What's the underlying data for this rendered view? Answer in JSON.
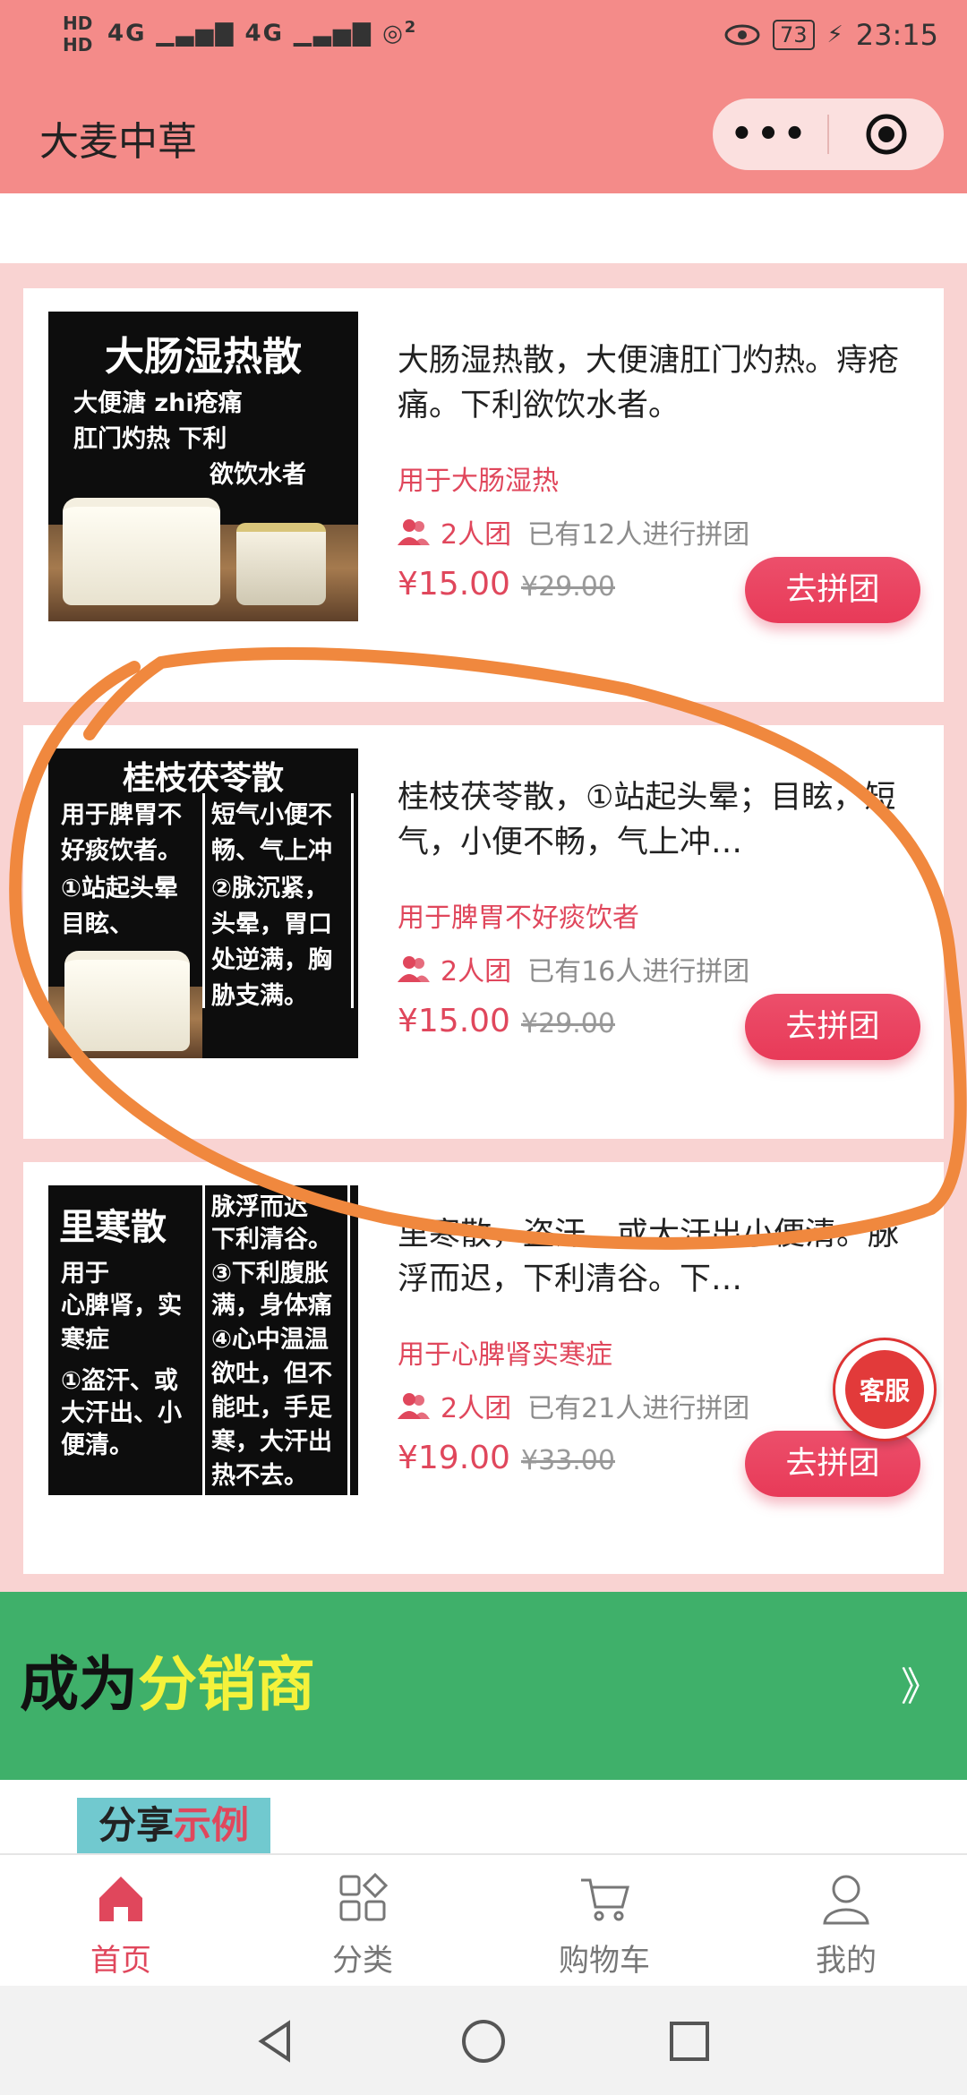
{
  "status_bar": {
    "hd1": "HD",
    "hd2": "HD",
    "net1": "4G",
    "net2": "4G",
    "wifi_badge": "2",
    "battery": "73",
    "time": "23:15"
  },
  "header": {
    "title": "大麦中草",
    "more_label": "•••"
  },
  "products": [
    {
      "thumb_title": "大肠湿热散",
      "thumb_lines": [
        "大便溏    zhi疮痛",
        "肛门灼热  下利",
        "欲饮水者"
      ],
      "desc": "大肠湿热散，大便溏肛门灼热。痔疮痛。下利欲饮水者。",
      "tag": "用于大肠湿热",
      "group_size": "2人团",
      "group_info": "已有12人进行拼团",
      "price": "¥15.00",
      "old_price": "¥29.00",
      "button": "去拼团"
    },
    {
      "thumb_title": "桂枝茯苓散",
      "thumb_lines_left": [
        "用于脾胃不",
        "好痰饮者。",
        "①站起头晕",
        "目眩、"
      ],
      "thumb_lines_right": [
        "短气小便不",
        "畅、气上冲",
        "②脉沉紧，",
        "头晕，胃口",
        "处逆满，胸",
        "胁支满。"
      ],
      "desc": "桂枝茯苓散，①站起头晕；目眩，短气，小便不畅，气上冲…",
      "tag": "用于脾胃不好痰饮者",
      "group_size": "2人团",
      "group_info": "已有16人进行拼团",
      "price": "¥15.00",
      "old_price": "¥29.00",
      "button": "去拼团"
    },
    {
      "thumb_title": "里寒散",
      "thumb_lines_left": [
        "用于",
        "心脾肾，实",
        "寒症",
        "①盗汗、或",
        "大汗出、小",
        "便清。"
      ],
      "thumb_lines_right": [
        "脉浮而迟",
        "下利清谷。",
        "③下利腹胀",
        "满，身体痛",
        "④心中温温",
        "欲吐，但不",
        "能吐，手足",
        "寒，大汗出",
        "热不去。"
      ],
      "desc": "里寒散，盗汗、或大汗出小便清。脉浮而迟，下利清谷。下…",
      "tag": "用于心脾肾实寒症",
      "group_size": "2人团",
      "group_info": "已有21人进行拼团",
      "price": "¥19.00",
      "old_price": "¥33.00",
      "button": "去拼团"
    }
  ],
  "distributor": {
    "title_a": "成为",
    "title_b": "分销商",
    "arrow": "》"
  },
  "share": {
    "label_a": "分享",
    "label_b": "示例"
  },
  "service": {
    "label": "客服"
  },
  "tabbar": [
    {
      "label": "首页",
      "icon": "home-icon",
      "active": true
    },
    {
      "label": "分类",
      "icon": "category-icon",
      "active": false
    },
    {
      "label": "购物车",
      "icon": "cart-icon",
      "active": false
    },
    {
      "label": "我的",
      "icon": "user-icon",
      "active": false
    }
  ],
  "colors": {
    "header_bg": "#f48b89",
    "accent": "#e0475c",
    "distributor_bg": "#3fb06a",
    "annotation": "#f0883e"
  }
}
